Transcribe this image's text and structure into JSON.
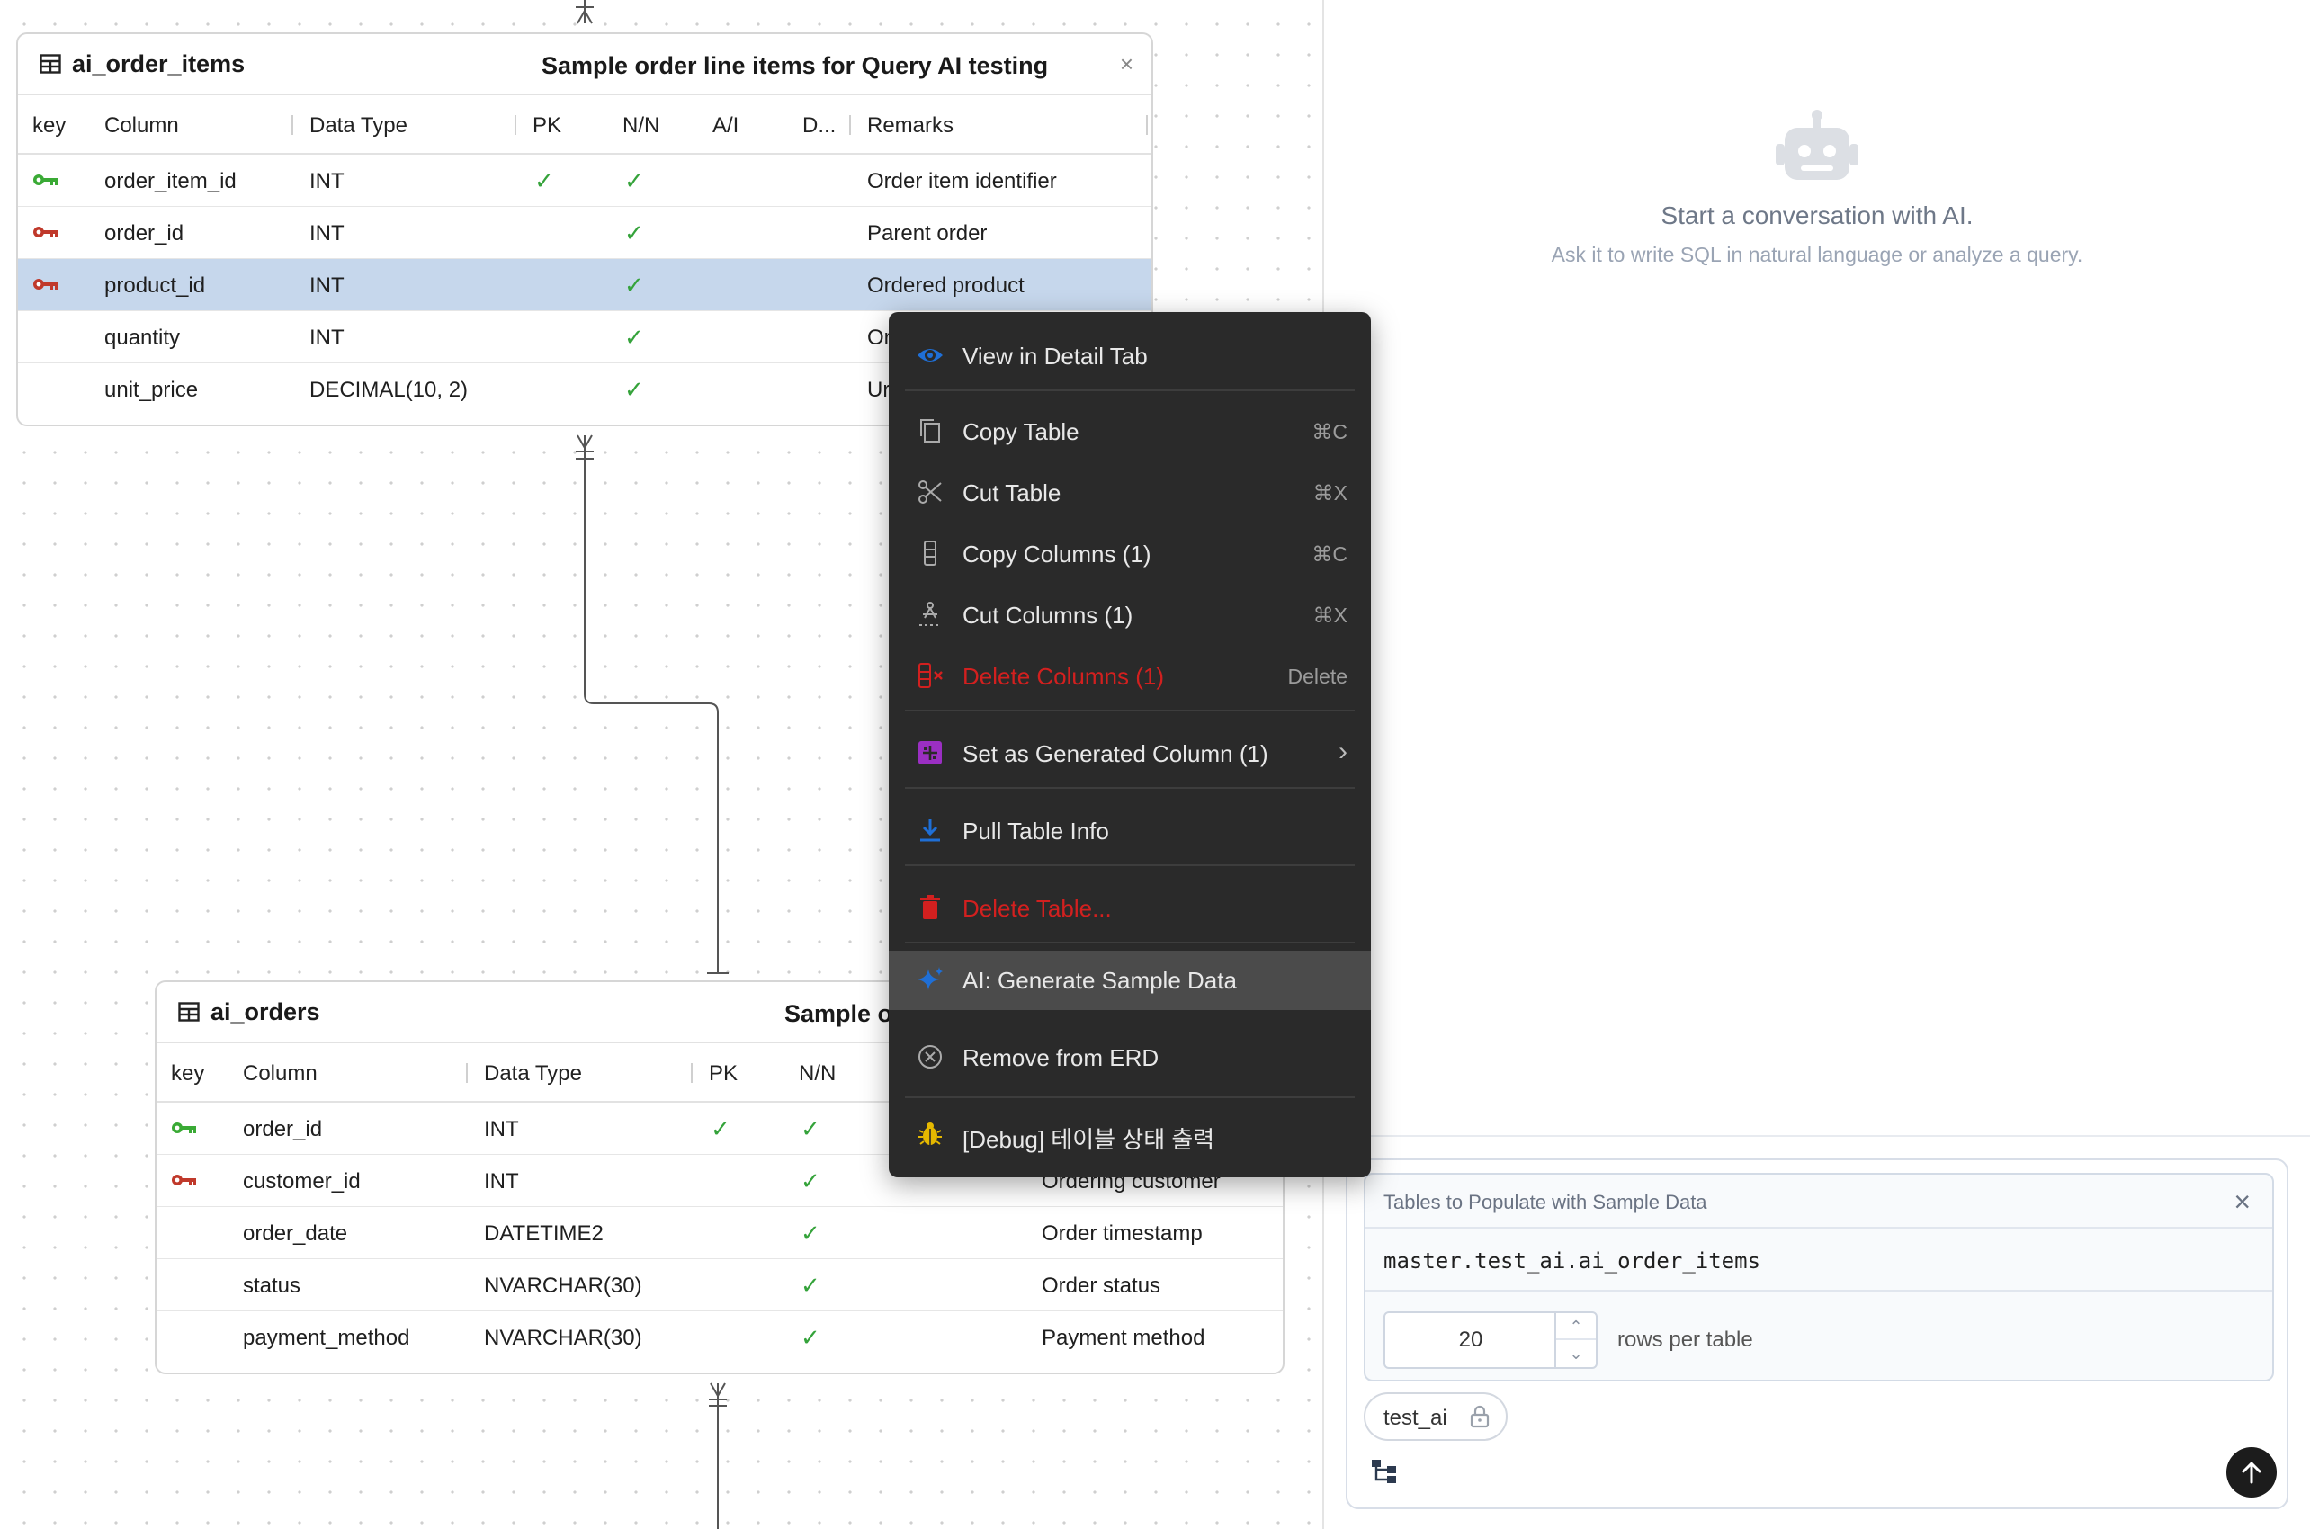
{
  "table1": {
    "name": "ai_order_items",
    "comment": "Sample order line items for Query AI testing",
    "close": "×",
    "headers": {
      "key": "key",
      "column": "Column",
      "type": "Data Type",
      "pk": "PK",
      "nn": "N/N",
      "ai": "A/I",
      "d": "D...",
      "remarks": "Remarks"
    },
    "rows": [
      {
        "column": "order_item_id",
        "type": "INT",
        "pk": "✓",
        "nn": "✓",
        "remarks": "Order item identifier",
        "key": "pk"
      },
      {
        "column": "order_id",
        "type": "INT",
        "pk": "",
        "nn": "✓",
        "remarks": "Parent order",
        "key": "fk"
      },
      {
        "column": "product_id",
        "type": "INT",
        "pk": "",
        "nn": "✓",
        "remarks": "Ordered product",
        "key": "fk"
      },
      {
        "column": "quantity",
        "type": "INT",
        "pk": "",
        "nn": "✓",
        "remarks": "Or",
        "key": ""
      },
      {
        "column": "unit_price",
        "type": "DECIMAL(10, 2)",
        "pk": "",
        "nn": "✓",
        "remarks": "Ur",
        "key": ""
      }
    ]
  },
  "table2": {
    "name": "ai_orders",
    "comment": "Sample o",
    "headers": {
      "key": "key",
      "column": "Column",
      "type": "Data Type",
      "pk": "PK",
      "nn": "N/N"
    },
    "rows": [
      {
        "column": "order_id",
        "type": "INT",
        "pk": "✓",
        "nn": "✓",
        "remarks": "",
        "key": "pk"
      },
      {
        "column": "customer_id",
        "type": "INT",
        "pk": "",
        "nn": "✓",
        "remarks": "Ordering customer",
        "key": "fk"
      },
      {
        "column": "order_date",
        "type": "DATETIME2",
        "pk": "",
        "nn": "✓",
        "remarks": "Order timestamp",
        "key": ""
      },
      {
        "column": "status",
        "type": "NVARCHAR(30)",
        "pk": "",
        "nn": "✓",
        "remarks": "Order status",
        "key": ""
      },
      {
        "column": "payment_method",
        "type": "NVARCHAR(30)",
        "pk": "",
        "nn": "✓",
        "remarks": "Payment method",
        "key": ""
      }
    ]
  },
  "menu": {
    "view_detail": "View in Detail Tab",
    "copy_table": "Copy Table",
    "copy_table_sc": "⌘C",
    "cut_table": "Cut Table",
    "cut_table_sc": "⌘X",
    "copy_cols": "Copy Columns (1)",
    "copy_cols_sc": "⌘C",
    "cut_cols": "Cut Columns (1)",
    "cut_cols_sc": "⌘X",
    "delete_cols": "Delete Columns (1)",
    "delete_cols_sc": "Delete",
    "set_generated": "Set as Generated Column (1)",
    "pull_info": "Pull Table Info",
    "delete_table": "Delete Table...",
    "ai_generate": "AI: Generate Sample Data",
    "remove_erd": "Remove from ERD",
    "debug": "[Debug] 테이블 상태 출력"
  },
  "ai": {
    "title": "Start a conversation with AI.",
    "subtitle": "Ask it to write SQL in natural language or analyze a query."
  },
  "sample_panel": {
    "header": "Tables to Populate with Sample Data",
    "table": "master.test_ai.ai_order_items",
    "rows_value": "20",
    "rows_label": "rows per table",
    "schema_chip": "test_ai"
  },
  "colors": {
    "pk_key": "#3aaa35",
    "fk_key": "#c0392b",
    "accent": "#1f6fd6",
    "danger": "#d2201f",
    "purple": "#9b2fc3",
    "debug": "#e5b800"
  }
}
